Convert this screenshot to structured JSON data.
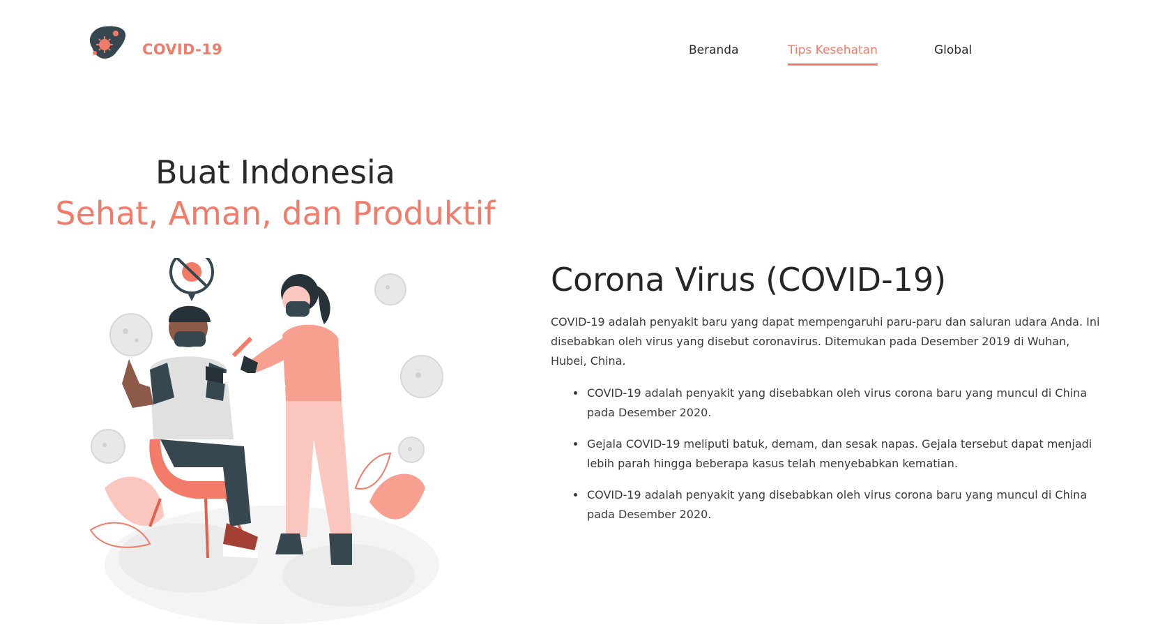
{
  "header": {
    "brand": "COVID-19",
    "logo_icon": "virus-logo-icon",
    "nav": [
      {
        "label": "Beranda",
        "active": false
      },
      {
        "label": "Tips Kesehatan",
        "active": true
      },
      {
        "label": "Global",
        "active": false
      }
    ]
  },
  "hero": {
    "line1": "Buat Indonesia",
    "line2": "Sehat, Aman, dan Produktif",
    "illustration": "vaccination-illustration"
  },
  "content": {
    "title": "Corona Virus (COVID-19)",
    "intro": "COVID-19 adalah penyakit baru yang dapat mempengaruhi paru-paru dan saluran udara Anda. Ini disebabkan oleh virus yang disebut coronavirus. Ditemukan pada Desember 2019 di Wuhan, Hubei, China.",
    "points": [
      "COVID-19 adalah penyakit yang disebabkan oleh virus corona baru yang muncul di China pada Desember 2020.",
      "Gejala COVID-19 meliputi batuk, demam, dan sesak napas. Gejala tersebut dapat menjadi lebih parah hingga beberapa kasus telah menyebabkan kematian.",
      "COVID-19 adalah penyakit yang disebabkan oleh virus corona baru yang muncul di China pada Desember 2020."
    ]
  },
  "colors": {
    "accent": "#f27b69",
    "dark": "#37474f",
    "text": "#2e2e2e"
  }
}
